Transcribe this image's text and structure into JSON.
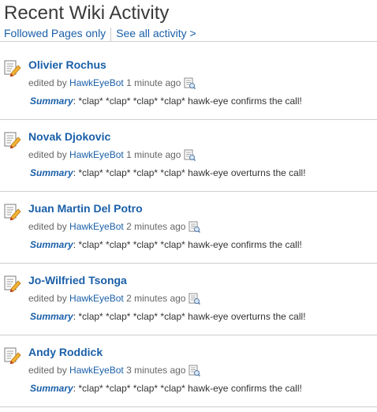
{
  "header": {
    "title": "Recent Wiki Activity",
    "filter_followed": "Followed Pages only",
    "filter_all": "See all activity >"
  },
  "activity": [
    {
      "page": "Olivier Rochus",
      "edited_by_prefix": "edited by",
      "user": "HawkEyeBot",
      "time": "1 minute ago",
      "summary_label": "Summary",
      "summary_text": ": *clap* *clap* *clap* *clap* hawk-eye confirms the call!"
    },
    {
      "page": "Novak Djokovic",
      "edited_by_prefix": "edited by",
      "user": "HawkEyeBot",
      "time": "1 minute ago",
      "summary_label": "Summary",
      "summary_text": ": *clap* *clap* *clap* *clap* hawk-eye overturns the call!"
    },
    {
      "page": "Juan Martin Del Potro",
      "edited_by_prefix": "edited by",
      "user": "HawkEyeBot",
      "time": "2 minutes ago",
      "summary_label": "Summary",
      "summary_text": ": *clap* *clap* *clap* *clap* hawk-eye confirms the call!"
    },
    {
      "page": "Jo-Wilfried Tsonga",
      "edited_by_prefix": "edited by",
      "user": "HawkEyeBot",
      "time": "2 minutes ago",
      "summary_label": "Summary",
      "summary_text": ": *clap* *clap* *clap* *clap* hawk-eye overturns the call!"
    },
    {
      "page": "Andy Roddick",
      "edited_by_prefix": "edited by",
      "user": "HawkEyeBot",
      "time": "3 minutes ago",
      "summary_label": "Summary",
      "summary_text": ": *clap* *clap* *clap* *clap* hawk-eye confirms the call!"
    }
  ],
  "icons": {
    "page_edit": "page-edit-icon",
    "diff": "diff-icon"
  },
  "colors": {
    "link": "#1a5fa8",
    "text": "#333333",
    "meta": "#666666",
    "divider": "#cfcfcf"
  }
}
